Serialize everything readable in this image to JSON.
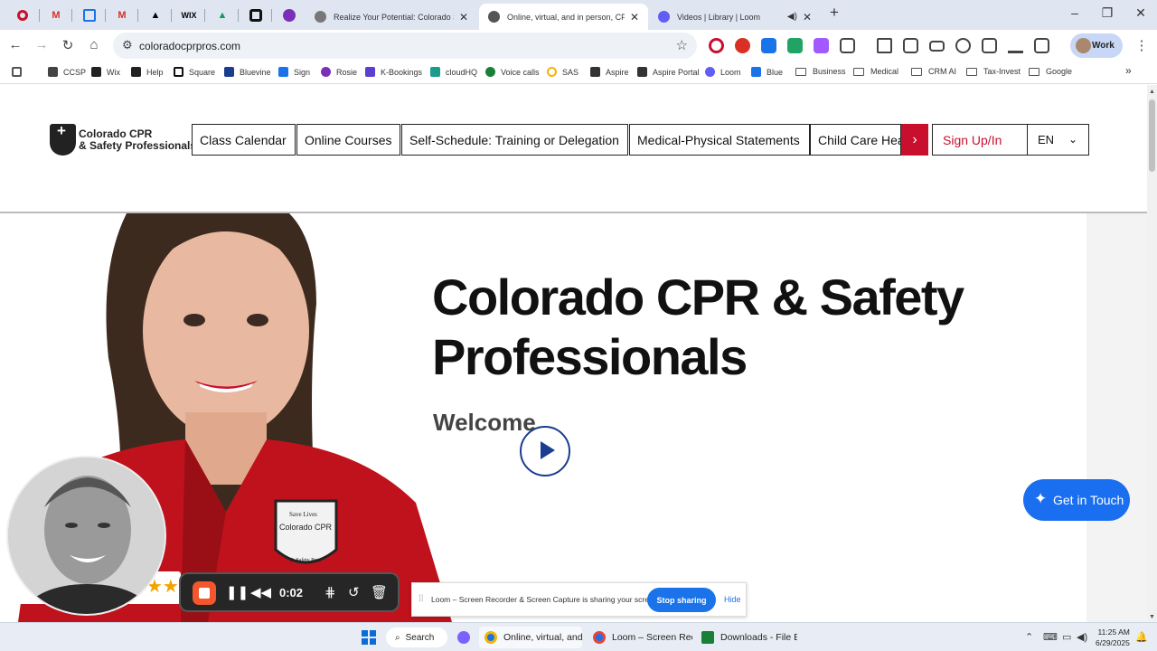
{
  "browser": {
    "tabs": [
      {
        "title": "Realize Your Potential: Colorado Shine",
        "active": false
      },
      {
        "title": "Online, virtual, and in person, CPR & F",
        "active": true
      },
      {
        "title": "Videos | Library | Loom",
        "active": false
      }
    ],
    "url": "coloradocprpros.com",
    "profile": "Work",
    "bookmarks": [
      "CCSP",
      "Wix",
      "Help",
      "Square",
      "Bluevine",
      "Sign",
      "Rosie",
      "K-Bookings",
      "cloudHQ",
      "Voice calls",
      "SAS",
      "Aspire",
      "Aspire Portal",
      "Loom",
      "Blue",
      "Business",
      "Medical",
      "CRM AI",
      "Tax-Invest",
      "Google"
    ],
    "bookmark_overflow": "»"
  },
  "site": {
    "logo_line1": "Colorado CPR",
    "logo_line2": "& Safety Professionals",
    "menu": [
      "Class Calendar",
      "Online Courses",
      "Self-Schedule: Training or Delegation",
      "Medical-Physical Statements",
      "Child Care Health"
    ],
    "menu_more": "›",
    "signup": "Sign Up/In",
    "lang": "EN",
    "hero_title": "Colorado CPR & Safety Professionals",
    "hero_sub": "Welcome",
    "get_in_touch": "Get in Touch",
    "shirt_badge_line1": "Save Lives",
    "shirt_badge_line2": "Colorado CPR",
    "shirt_badge_line3": "& Safety Pros"
  },
  "loom": {
    "time": "0:02",
    "share_message": "Loom – Screen Recorder & Screen Capture is sharing your screen.",
    "stop_sharing": "Stop sharing",
    "hide": "Hide",
    "stars": "★★"
  },
  "taskbar": {
    "search": "Search",
    "apps": [
      "Online, virtual, and i",
      "Loom – Screen Reco",
      "Downloads - File Exp"
    ],
    "time": "11:25 AM",
    "date": "6/29/2025"
  },
  "colors": {
    "brand_red": "#c8102e",
    "accent_blue": "#1a6ff0",
    "loom_orange": "#f4562d"
  }
}
